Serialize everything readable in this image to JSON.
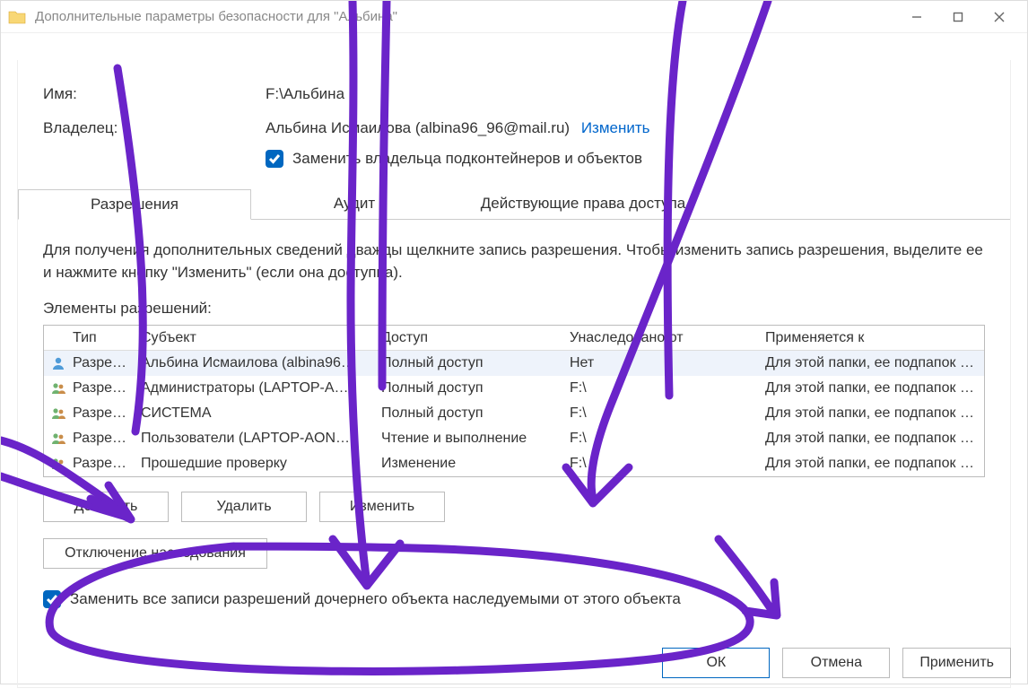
{
  "window": {
    "title": "Дополнительные параметры безопасности  для \"Альбина\""
  },
  "header": {
    "name_label": "Имя:",
    "name_value": "F:\\Альбина",
    "owner_label": "Владелец:",
    "owner_value": "Альбина Исмаилова (albina96_96@mail.ru)",
    "change_link": "Изменить",
    "replace_owner_checkbox": "Заменить владельца подконтейнеров и объектов"
  },
  "tabs": {
    "permissions": "Разрешения",
    "audit": "Аудит",
    "effective": "Действующие права доступа"
  },
  "permissions_panel": {
    "instructions": "Для получения дополнительных сведений дважды щелкните запись разрешения. Чтобы изменить запись разрешения, выделите ее и нажмите кнопку \"Изменить\" (если она доступна).",
    "list_label": "Элементы разрешений:",
    "columns": {
      "type": "Тип",
      "subject": "Субъект",
      "access": "Доступ",
      "inherited": "Унаследовано от",
      "applies": "Применяется к"
    },
    "rows": [
      {
        "icon": "user",
        "type": "Разре…",
        "subject": "Альбина Исмаилова (albina96…",
        "access": "Полный доступ",
        "inherited": "Нет",
        "applies": "Для этой папки, ее подпапок …"
      },
      {
        "icon": "group",
        "type": "Разре…",
        "subject": "Администраторы (LAPTOP-A…",
        "access": "Полный доступ",
        "inherited": "F:\\",
        "applies": "Для этой папки, ее подпапок …"
      },
      {
        "icon": "group",
        "type": "Разре…",
        "subject": "СИСТЕМА",
        "access": "Полный доступ",
        "inherited": "F:\\",
        "applies": "Для этой папки, ее подпапок …"
      },
      {
        "icon": "group",
        "type": "Разре…",
        "subject": "Пользователи (LAPTOP-AON…",
        "access": "Чтение и выполнение",
        "inherited": "F:\\",
        "applies": "Для этой папки, ее подпапок …"
      },
      {
        "icon": "group",
        "type": "Разре…",
        "subject": "Прошедшие проверку",
        "access": "Изменение",
        "inherited": "F:\\",
        "applies": "Для этой папки, ее подпапок …"
      }
    ],
    "buttons": {
      "add": "Добавить",
      "remove": "Удалить",
      "edit": "Изменить",
      "disable_inheritance": "Отключение наследования"
    },
    "replace_child_checkbox": "Заменить все записи разрешений дочернего объекта наследуемыми от этого объекта"
  },
  "dialog_buttons": {
    "ok": "ОК",
    "cancel": "Отмена",
    "apply": "Применить"
  }
}
